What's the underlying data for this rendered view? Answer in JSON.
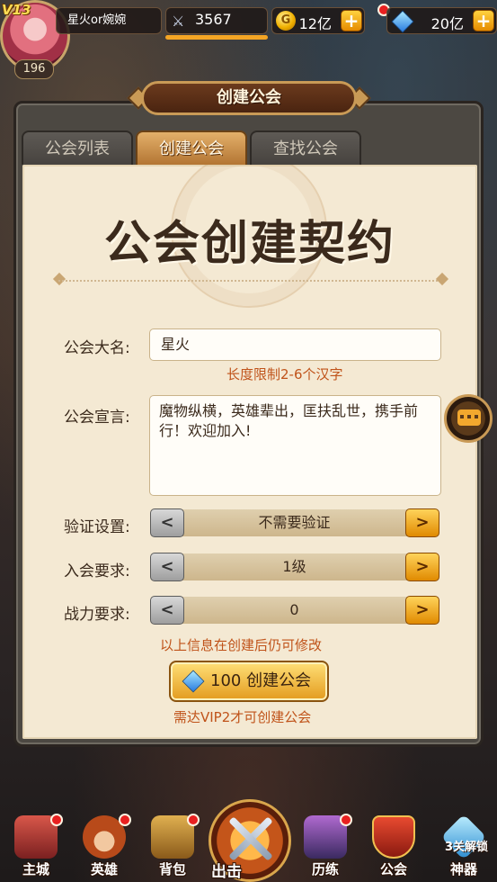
{
  "player": {
    "vip": "V13",
    "level": "196",
    "name": "星火or婉婉",
    "power": "3567",
    "power_progress": 1.0
  },
  "currency": {
    "gold_icon_letter": "G",
    "gold": "12亿",
    "gems": "20亿",
    "plus": "+"
  },
  "window": {
    "title": "创建公会",
    "tabs": [
      {
        "label": "公会列表"
      },
      {
        "label": "创建公会"
      },
      {
        "label": "查找公会"
      }
    ],
    "active_tab": 1
  },
  "form": {
    "heading": "公会创建契约",
    "name_label": "公会大名:",
    "name_value": "星火",
    "name_hint": "长度限制2-6个汉字",
    "manifesto_label": "公会宣言:",
    "manifesto_value": "魔物纵横，英雄辈出，匡扶乱世，携手前行！欢迎加入!",
    "verify_label": "验证设置:",
    "verify_value": "不需要验证",
    "join_label": "入会要求:",
    "join_value": "1级",
    "power_label": "战力要求:",
    "power_value": "0",
    "prev": "<",
    "next": ">",
    "note": "以上信息在创建后仍可修改",
    "create_button": "100 创建公会",
    "create_cost": 100,
    "vip_requirement": "需达VIP2才可创建公会"
  },
  "nav": [
    {
      "label": "主城",
      "icon": "castle-icon",
      "badge": true
    },
    {
      "label": "英雄",
      "icon": "hero-icon",
      "badge": true
    },
    {
      "label": "背包",
      "icon": "backpack-icon",
      "badge": true
    },
    {
      "label": "出击",
      "icon": "crossed-swords-icon",
      "badge": false
    },
    {
      "label": "历练",
      "icon": "tower-icon",
      "badge": true
    },
    {
      "label": "公会",
      "icon": "guild-shield-icon",
      "badge": false
    },
    {
      "label": "神器",
      "icon": "artifact-crystal-icon",
      "badge": false,
      "lock_text": "3关解锁"
    }
  ],
  "colors": {
    "accent_gold": "#e39b1e",
    "hint_red": "#c0531a",
    "paper": "#f4e9d3",
    "badge_red": "#e82020"
  }
}
